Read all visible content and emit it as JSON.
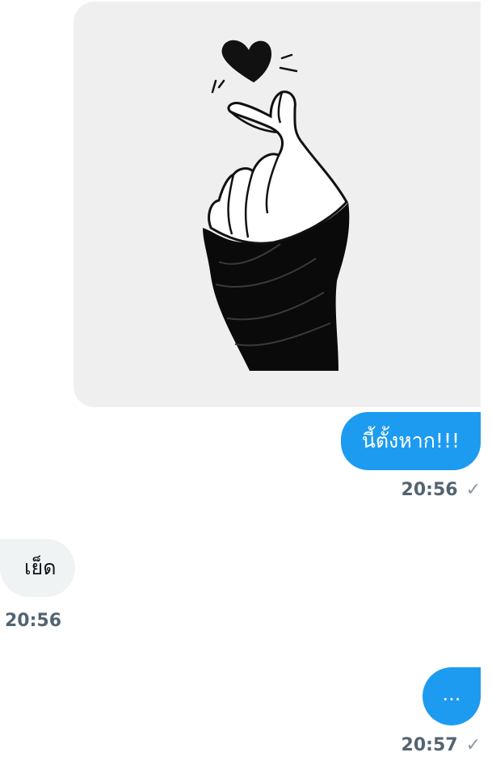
{
  "messages": [
    {
      "direction": "outgoing",
      "type": "image",
      "image_alt": "finger-heart-hand-illustration"
    },
    {
      "direction": "outgoing",
      "type": "text",
      "text": "นี้ตั้งหาก!!!"
    },
    {
      "direction": "outgoing",
      "type": "meta",
      "time": "20:56",
      "status_icon": "check-icon"
    },
    {
      "direction": "incoming",
      "type": "text",
      "text": "เย็ด"
    },
    {
      "direction": "incoming",
      "type": "meta",
      "time": "20:56"
    },
    {
      "direction": "outgoing",
      "type": "text",
      "text": "..."
    },
    {
      "direction": "outgoing",
      "type": "meta",
      "time": "20:57",
      "status_icon": "check-icon"
    }
  ],
  "ui": {
    "check_glyph": "✓",
    "colors": {
      "outgoing_bubble": "#1d9bf0",
      "incoming_bubble": "#eff3f4",
      "image_bubble_bg": "#efefef",
      "timestamp": "#536471"
    }
  }
}
